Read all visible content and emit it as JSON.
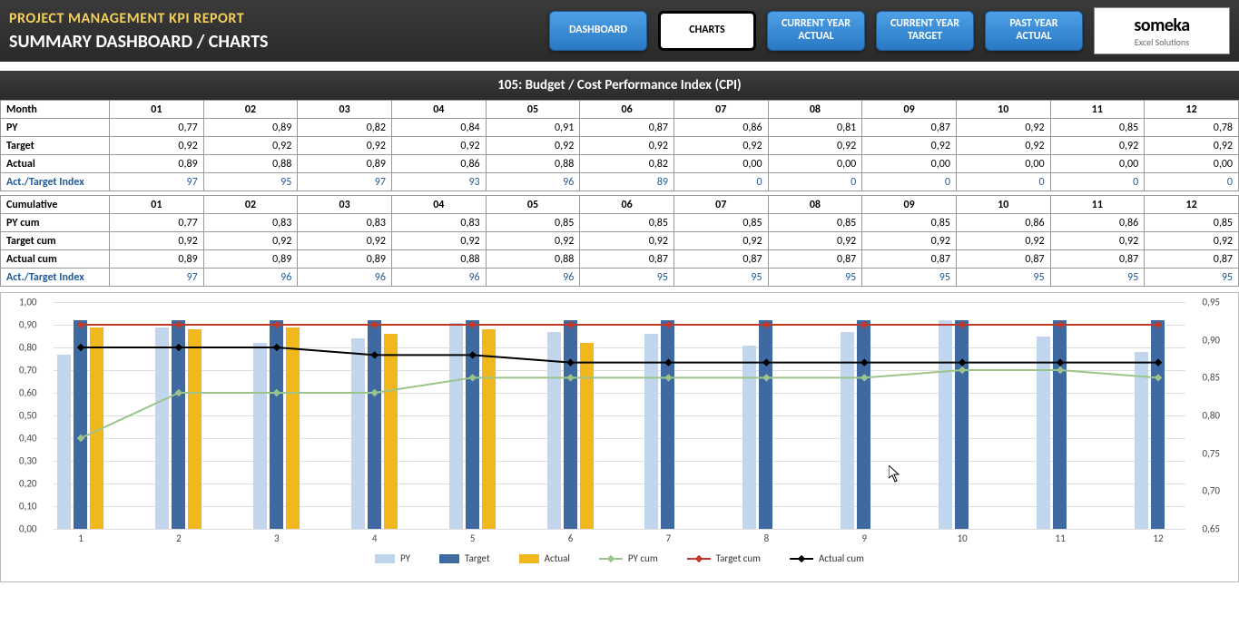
{
  "header": {
    "title1": "PROJECT MANAGEMENT KPI REPORT",
    "title2": "SUMMARY DASHBOARD / CHARTS",
    "nav": {
      "dashboard": "DASHBOARD",
      "charts": "CHARTS",
      "cy_actual": "CURRENT YEAR ACTUAL",
      "cy_target": "CURRENT YEAR TARGET",
      "py_actual": "PAST YEAR ACTUAL"
    },
    "logo": {
      "main": "someka",
      "sub": "Excel Solutions"
    }
  },
  "banner": "105: Budget / Cost Performance Index (CPI)",
  "months": [
    "01",
    "02",
    "03",
    "04",
    "05",
    "06",
    "07",
    "08",
    "09",
    "10",
    "11",
    "12"
  ],
  "table_monthly": {
    "header": "Month",
    "rows": [
      {
        "label": "PY",
        "values": [
          "0,77",
          "0,89",
          "0,82",
          "0,84",
          "0,91",
          "0,87",
          "0,86",
          "0,81",
          "0,87",
          "0,92",
          "0,85",
          "0,78"
        ]
      },
      {
        "label": "Target",
        "values": [
          "0,92",
          "0,92",
          "0,92",
          "0,92",
          "0,92",
          "0,92",
          "0,92",
          "0,92",
          "0,92",
          "0,92",
          "0,92",
          "0,92"
        ]
      },
      {
        "label": "Actual",
        "values": [
          "0,89",
          "0,88",
          "0,89",
          "0,86",
          "0,88",
          "0,82",
          "0,00",
          "0,00",
          "0,00",
          "0,00",
          "0,00",
          "0,00"
        ]
      },
      {
        "label": "Act./Target Index",
        "values": [
          "97",
          "95",
          "97",
          "93",
          "96",
          "89",
          "0",
          "0",
          "0",
          "0",
          "0",
          "0"
        ],
        "class": "idx"
      }
    ]
  },
  "table_cum": {
    "header": "Cumulative",
    "rows": [
      {
        "label": "PY cum",
        "values": [
          "0,77",
          "0,83",
          "0,83",
          "0,83",
          "0,85",
          "0,85",
          "0,85",
          "0,85",
          "0,85",
          "0,86",
          "0,86",
          "0,85"
        ]
      },
      {
        "label": "Target cum",
        "values": [
          "0,92",
          "0,92",
          "0,92",
          "0,92",
          "0,92",
          "0,92",
          "0,92",
          "0,92",
          "0,92",
          "0,92",
          "0,92",
          "0,92"
        ]
      },
      {
        "label": "Actual cum",
        "values": [
          "0,89",
          "0,89",
          "0,89",
          "0,88",
          "0,88",
          "0,87",
          "0,87",
          "0,87",
          "0,87",
          "0,87",
          "0,87",
          "0,87"
        ]
      },
      {
        "label": "Act./Target Index",
        "values": [
          "97",
          "96",
          "96",
          "96",
          "96",
          "95",
          "95",
          "95",
          "95",
          "95",
          "95",
          "95"
        ],
        "class": "idx"
      }
    ]
  },
  "chart_data": {
    "type": "bar+line",
    "x": [
      1,
      2,
      3,
      4,
      5,
      6,
      7,
      8,
      9,
      10,
      11,
      12
    ],
    "left_axis": {
      "min": 0.0,
      "max": 1.0,
      "ticks": [
        "0,00",
        "0,10",
        "0,20",
        "0,30",
        "0,40",
        "0,50",
        "0,60",
        "0,70",
        "0,80",
        "0,90",
        "1,00"
      ]
    },
    "right_axis": {
      "min": 0.65,
      "max": 0.95,
      "ticks": [
        "0,65",
        "0,70",
        "0,75",
        "0,80",
        "0,85",
        "0,90",
        "0,95"
      ]
    },
    "bars": [
      {
        "name": "PY",
        "axis": "left",
        "values": [
          0.77,
          0.89,
          0.82,
          0.84,
          0.91,
          0.87,
          0.86,
          0.81,
          0.87,
          0.92,
          0.85,
          0.78
        ],
        "color": "#c1d6ed"
      },
      {
        "name": "Target",
        "axis": "left",
        "values": [
          0.92,
          0.92,
          0.92,
          0.92,
          0.92,
          0.92,
          0.92,
          0.92,
          0.92,
          0.92,
          0.92,
          0.92
        ],
        "color": "#3f6aa1"
      },
      {
        "name": "Actual",
        "axis": "left",
        "values": [
          0.89,
          0.88,
          0.89,
          0.86,
          0.88,
          0.82,
          0,
          0,
          0,
          0,
          0,
          0
        ],
        "color": "#f0b81c"
      }
    ],
    "lines": [
      {
        "name": "PY cum",
        "axis": "right",
        "values": [
          0.77,
          0.83,
          0.83,
          0.83,
          0.85,
          0.85,
          0.85,
          0.85,
          0.85,
          0.86,
          0.86,
          0.85
        ],
        "color": "#9bc48a"
      },
      {
        "name": "Target cum",
        "axis": "right",
        "values": [
          0.92,
          0.92,
          0.92,
          0.92,
          0.92,
          0.92,
          0.92,
          0.92,
          0.92,
          0.92,
          0.92,
          0.92
        ],
        "color": "#c0392b"
      },
      {
        "name": "Actual cum",
        "axis": "right",
        "values": [
          0.89,
          0.89,
          0.89,
          0.88,
          0.88,
          0.87,
          0.87,
          0.87,
          0.87,
          0.87,
          0.87,
          0.87
        ],
        "color": "#000000"
      }
    ],
    "legend": [
      "PY",
      "Target",
      "Actual",
      "PY cum",
      "Target cum",
      "Actual cum"
    ]
  }
}
